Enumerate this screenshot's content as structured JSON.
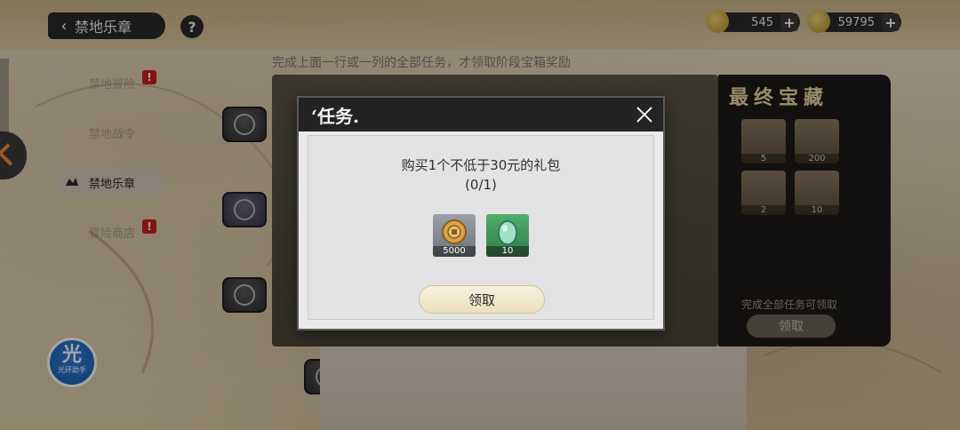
{
  "header": {
    "back_label": "禁地乐章",
    "help_label": "?"
  },
  "currencies": [
    {
      "icon": "gold-coin-icon",
      "value": "545",
      "plus": "+"
    },
    {
      "icon": "gem-currency-icon",
      "value": "59795",
      "plus": "+"
    }
  ],
  "sidebar": {
    "items": [
      {
        "label": "禁地冒险",
        "alert": "!"
      },
      {
        "label": "禁地战令",
        "alert": ""
      },
      {
        "label": "禁地乐章",
        "alert": ""
      },
      {
        "label": "冒险商店",
        "alert": "!"
      }
    ]
  },
  "background": {
    "subtitle": "完成上面一行或一列的全部任务，才领取阶段宝箱奖励",
    "final_reward": {
      "title": "最终宝藏",
      "items": [
        {
          "name": "dice-icon",
          "count": "5"
        },
        {
          "name": "duck-icon",
          "count": "200"
        },
        {
          "name": "crab-icon",
          "count": "2"
        },
        {
          "name": "cake-icon",
          "count": "10"
        }
      ],
      "hint": "完成全部任务可领取",
      "claim_label": "领取"
    }
  },
  "modal": {
    "title": "‘任务.",
    "description": "购买1个不低于30元的礼包",
    "progress": "(0/1)",
    "rewards": [
      {
        "icon": "coin-icon",
        "quantity": "5000",
        "rarity_color": "#8a9096"
      },
      {
        "icon": "egg-icon",
        "quantity": "10",
        "rarity_color": "#3f9a5c"
      }
    ],
    "claim_label": "领取"
  },
  "logo": {
    "char": "光",
    "sub": "光环助手"
  }
}
